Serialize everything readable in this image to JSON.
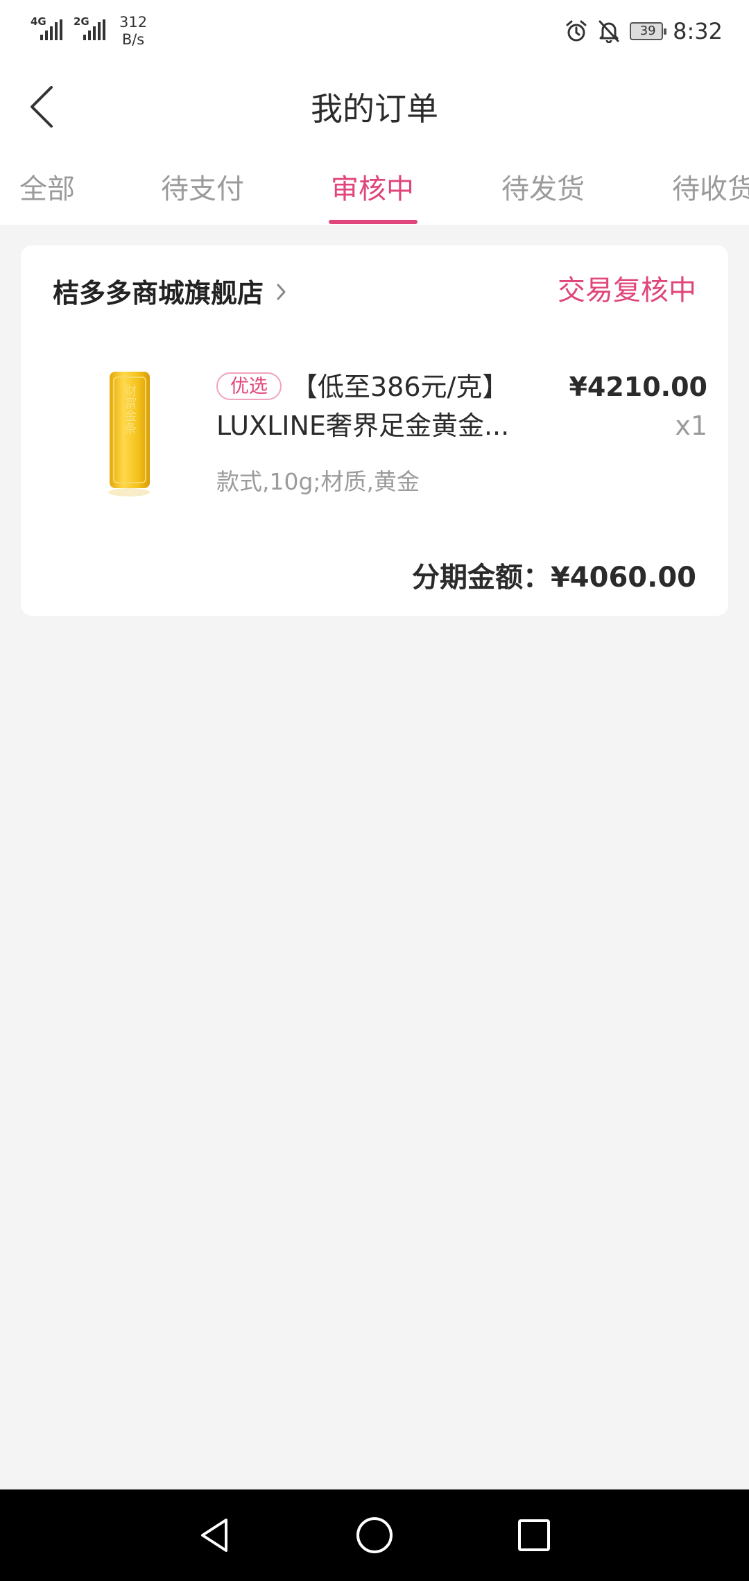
{
  "status_bar": {
    "sim1_network": "4G",
    "sim2_network": "2G",
    "speed_value": "312",
    "speed_unit": "B/s",
    "battery": "39",
    "time": "8:32",
    "icons": [
      "alarm-icon",
      "bell-off-icon",
      "battery-icon"
    ]
  },
  "header": {
    "title": "我的订单",
    "back_icon": "chevron-left-icon"
  },
  "tabs": [
    {
      "label": "全部"
    },
    {
      "label": "待支付"
    },
    {
      "label": "审核中"
    },
    {
      "label": "待发货"
    },
    {
      "label": "待收货"
    }
  ],
  "active_tab": "审核中",
  "order": {
    "store_name": "桔多多商城旗舰店",
    "status": "交易复核中",
    "product": {
      "tag": "优选",
      "title_line1": "【低至386元/克】",
      "title_line2": "LUXLINE奢界足金黄金...",
      "spec": "款式,10g;材质,黄金",
      "price": "¥4210.00",
      "quantity": "x1",
      "image_text": "财富金条"
    },
    "installment_label": "分期金额：",
    "installment_amount": "¥4060.00"
  },
  "colors": {
    "accent": "#e0457b",
    "background": "#f5f4f4",
    "gold": "#f4c21c"
  },
  "nav_bar": {
    "icons": [
      "back-triangle-icon",
      "home-circle-icon",
      "recents-square-icon"
    ]
  }
}
